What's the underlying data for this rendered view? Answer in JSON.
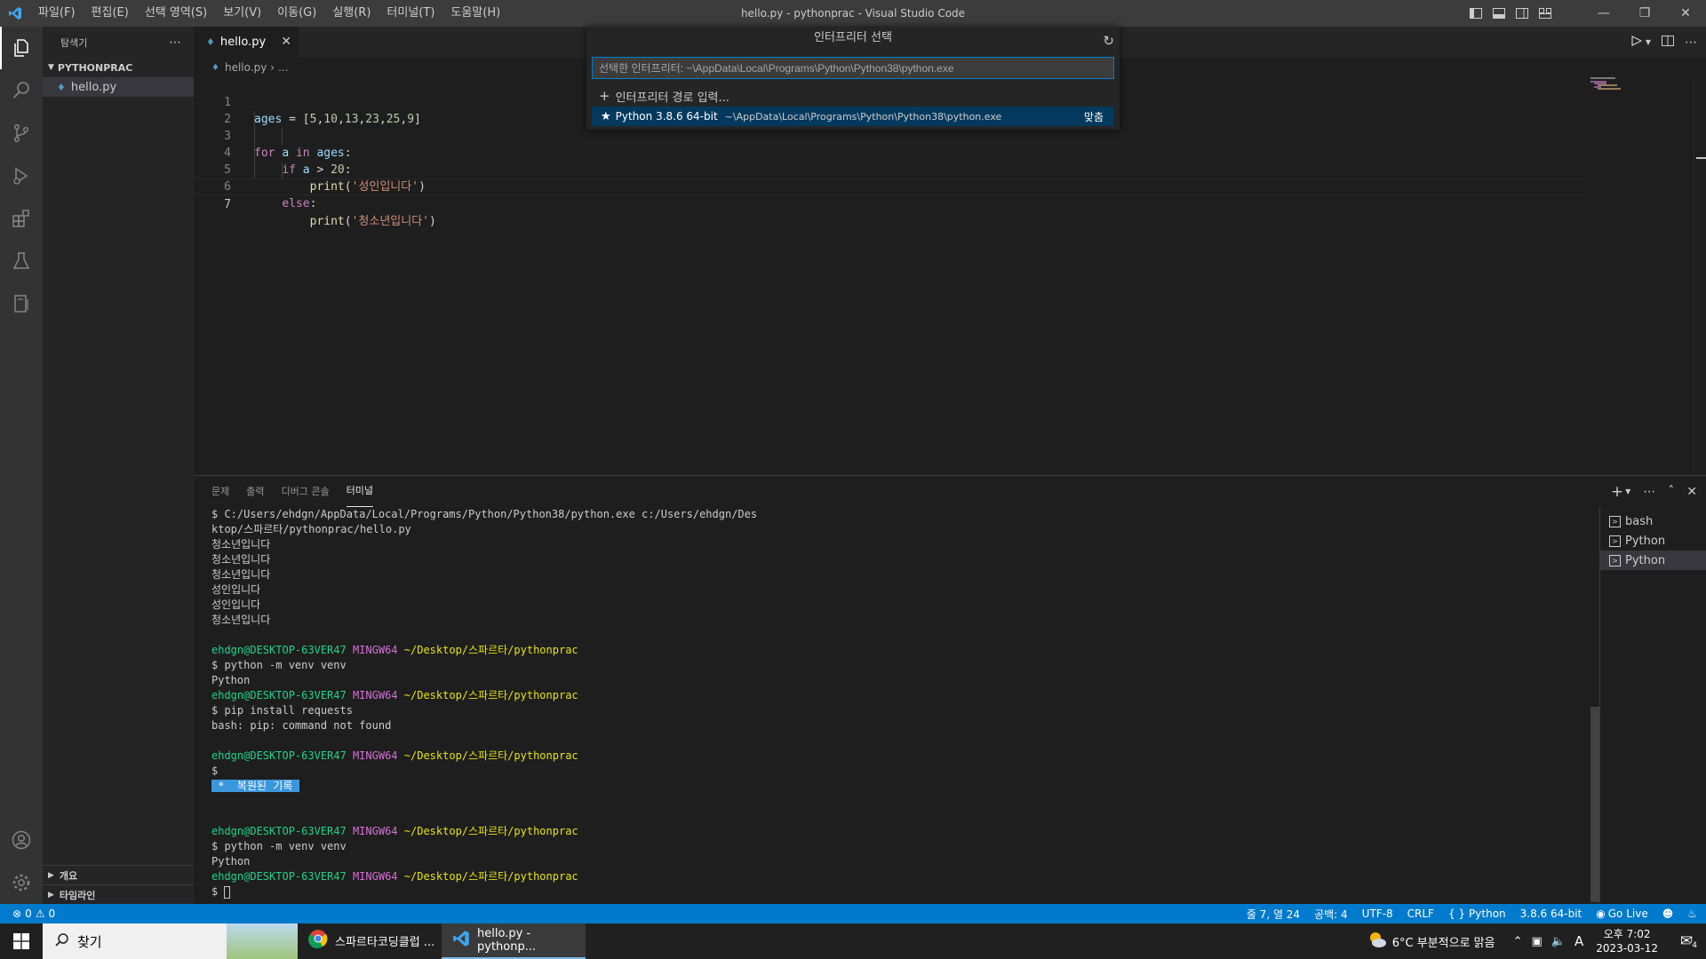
{
  "titlebar": {
    "menu": [
      "파일(F)",
      "편집(E)",
      "선택 영역(S)",
      "보기(V)",
      "이동(G)",
      "실행(R)",
      "터미널(T)",
      "도움말(H)"
    ],
    "title": "hello.py - pythonprac - Visual Studio Code"
  },
  "sidebar": {
    "header": "탐색기",
    "folder": "PYTHONPRAC",
    "file": "hello.py",
    "outline": "개요",
    "timeline": "타임라인"
  },
  "editor": {
    "tab_label": "hello.py",
    "breadcrumb_file": "hello.py",
    "breadcrumb_rest": "...",
    "lines": [
      {
        "num": "1",
        "code": "ages = [5,10,13,23,25,9]"
      },
      {
        "num": "2",
        "code": ""
      },
      {
        "num": "3",
        "code": "for a in ages:"
      },
      {
        "num": "4",
        "code": "if a > 20:"
      },
      {
        "num": "5",
        "code": "print('성인입니다')"
      },
      {
        "num": "6",
        "code": "else:"
      },
      {
        "num": "7",
        "code": "print('청소년입니다')"
      }
    ]
  },
  "quickpick": {
    "title": "인터프리터 선택",
    "input_value": "선택한 인터프리터: ~\\AppData\\Local\\Programs\\Python\\Python38\\python.exe",
    "enter_path": "인터프리터 경로 입력...",
    "item_label": "Python 3.8.6 64-bit",
    "item_path": "~\\AppData\\Local\\Programs\\Python\\Python38\\python.exe",
    "item_badge": "맞춤"
  },
  "panel": {
    "tabs": [
      "문제",
      "출력",
      "디버그 콘솔",
      "터미널"
    ],
    "terminal_list": [
      "bash",
      "Python",
      "Python"
    ],
    "terminal": {
      "cmd1a": "$ C:/Users/ehdgn/AppData/Local/Programs/Python/Python38/python.exe c:/Users/ehdgn/Des",
      "cmd1b": "ktop/스파르타/pythonprac/hello.py",
      "out": [
        "청소년입니다",
        "청소년입니다",
        "청소년입니다",
        "성인입니다",
        "성인입니다",
        "청소년입니다"
      ],
      "user": "ehdgn@DESKTOP-63VER47",
      "shell": "MINGW64",
      "path": "~/Desktop/스파르타/pythonprac",
      "cmd_venv": "$ python -m venv venv",
      "python_out": "Python",
      "cmd_pip": "$ pip install requests",
      "pip_err": "bash: pip: command not found",
      "dollar": "$",
      "restored": " *  복원된 기록 "
    }
  },
  "statusbar": {
    "errors": "0",
    "warnings": "0",
    "position": "줄 7, 열 24",
    "spaces": "공백: 4",
    "encoding": "UTF-8",
    "eol": "CRLF",
    "language": "Python",
    "interpreter": "3.8.6 64-bit",
    "golive": "Go Live"
  },
  "taskbar": {
    "search": "찾기",
    "app1": "스파르타코딩클럽 ...",
    "app2": "hello.py - pythonp...",
    "weather": "6°C  부분적으로 맑음",
    "time": "오후 7:02",
    "date": "2023-03-12",
    "notif_count": "4",
    "ime": "A"
  },
  "colors": {
    "accent": "#007acc",
    "selection": "#04395e",
    "terminal_green": "#23d18b",
    "terminal_magenta": "#d670d6",
    "terminal_yellow": "#e5e510"
  }
}
